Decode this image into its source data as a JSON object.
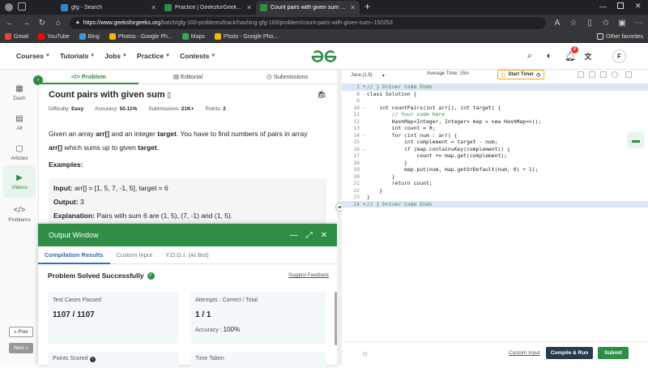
{
  "browser": {
    "tabs": [
      {
        "title": "gfg - Search",
        "color": "#2b87d1"
      },
      {
        "title": "Practice | GeeksforGeeks | A com",
        "color": "#2f8d46"
      },
      {
        "title": "Count pairs with given sum | Prac",
        "color": "#2f8d46"
      }
    ],
    "url_host": "https://www.geeksforgeeks.org",
    "url_path": "/batch/gfg-160-problems/track/hashing-gfg-160/problem/count-pairs-with-given-sum--150253",
    "bookmarks": [
      {
        "label": "Gmail",
        "color": "#ea4335"
      },
      {
        "label": "YouTube",
        "color": "#ff0000"
      },
      {
        "label": "Bing",
        "color": "#4c8fd6"
      },
      {
        "label": "Photos - Google Ph...",
        "color": "#f4b400"
      },
      {
        "label": "Maps",
        "color": "#34a853"
      },
      {
        "label": "Photo - Google Pho...",
        "color": "#f4b400"
      }
    ],
    "other_favorites": "Other favorites"
  },
  "site": {
    "nav": [
      "Courses",
      "Tutorials",
      "Jobs",
      "Practice",
      "Contests"
    ],
    "notification_count": "8",
    "avatar_letter": "F",
    "brand_color": "#2f8d46"
  },
  "rail": {
    "items": [
      {
        "label": "Dash",
        "icon": "dashboard-icon"
      },
      {
        "label": "All",
        "icon": "grid-icon"
      },
      {
        "label": "Articles",
        "icon": "article-icon"
      },
      {
        "label": "Videos",
        "icon": "video-icon"
      },
      {
        "label": "Problems",
        "icon": "code-icon"
      }
    ],
    "prev": "« Prev",
    "next": "Next »"
  },
  "problem": {
    "tabs": [
      "</> Problem",
      "Editorial",
      "Submissions"
    ],
    "title": "Count pairs with given sum",
    "difficulty_label": "Difficulty:",
    "difficulty": "Easy",
    "accuracy_label": "Accuracy:",
    "accuracy": "50.11%",
    "submissions_label": "Submissions:",
    "submissions": "21K+",
    "points_label": "Points:",
    "points": "2",
    "desc_1": "Given an array ",
    "desc_arr": "arr[]",
    "desc_2": " and an integer ",
    "desc_target": "target",
    "desc_3": ". You have to find numbers of pairs in array ",
    "desc_arr2": "arr[]",
    "desc_4": " which sums up to given ",
    "desc_target2": "target",
    "desc_5": ".",
    "examples": "Examples:",
    "ex_input_label": "Input:",
    "ex_input": " arr[] = [1, 5, 7, -1, 5], target = 6",
    "ex_output_label": "Output:",
    "ex_output": " 3",
    "ex_expl_label": "Explanation:",
    "ex_expl": " Pairs with sum 6 are (1, 5), (7, -1) and (1, 5)."
  },
  "output": {
    "title": "Output Window",
    "tabs": [
      "Compilation Results",
      "Custom Input",
      "Y.O.G.I. (AI Bot)"
    ],
    "status": "Problem Solved Successfully",
    "feedback": "Suggest Feedback",
    "tests_label": "Test Cases Passed",
    "tests_value": "1107 / 1107",
    "attempts_label": "Attempts : Correct / Total",
    "attempts_value": "1 / 1",
    "accuracy_label": "Accuracy :",
    "accuracy_value": "100%",
    "points_label": "Points Scored",
    "time_label": "Time Taken"
  },
  "editor": {
    "language": "Java (1.8)",
    "avg_time": "Average Time: 15m",
    "timer": "Start Timer",
    "custom_input": "Custom Input",
    "compile": "Compile & Run",
    "submit": "Submit",
    "lines": [
      {
        "n": "1",
        "fold": "+",
        "text": "// } Driver Code Ends",
        "hl": true,
        "cls": "cm"
      },
      {
        "n": "8",
        "fold": "-",
        "text": "class Solution {",
        "hl": false,
        "cls": ""
      },
      {
        "n": "9",
        "fold": "",
        "text": "",
        "hl": false,
        "cls": ""
      },
      {
        "n": "10",
        "fold": "-",
        "text": "    int countPairs(int arr[], int target) {",
        "hl": false,
        "cls": ""
      },
      {
        "n": "11",
        "fold": "",
        "text": "        // Your code here",
        "hl": false,
        "cls": "cm"
      },
      {
        "n": "12",
        "fold": "",
        "text": "        HashMap<Integer, Integer> map = new HashMap<>();",
        "hl": false,
        "cls": ""
      },
      {
        "n": "13",
        "fold": "",
        "text": "        int count = 0;",
        "hl": false,
        "cls": ""
      },
      {
        "n": "14",
        "fold": "-",
        "text": "        for (int num : arr) {",
        "hl": false,
        "cls": ""
      },
      {
        "n": "15",
        "fold": "",
        "text": "            int complement = target - num;",
        "hl": false,
        "cls": ""
      },
      {
        "n": "16",
        "fold": "-",
        "text": "            if (map.containsKey(complement)) {",
        "hl": false,
        "cls": ""
      },
      {
        "n": "17",
        "fold": "",
        "text": "                count += map.get(complement);",
        "hl": false,
        "cls": ""
      },
      {
        "n": "18",
        "fold": "",
        "text": "            }",
        "hl": false,
        "cls": ""
      },
      {
        "n": "19",
        "fold": "",
        "text": "            map.put(num, map.getOrDefault(num, 0) + 1);",
        "hl": false,
        "cls": ""
      },
      {
        "n": "20",
        "fold": "",
        "text": "        }",
        "hl": false,
        "cls": ""
      },
      {
        "n": "21",
        "fold": "",
        "text": "        return count;",
        "hl": false,
        "cls": ""
      },
      {
        "n": "22",
        "fold": "",
        "text": "    }",
        "hl": false,
        "cls": ""
      },
      {
        "n": "23",
        "fold": "",
        "text": "}",
        "hl": false,
        "cls": ""
      },
      {
        "n": "24",
        "fold": "+",
        "text": "// } Driver Code Ends",
        "hl": true,
        "cls": "cm"
      }
    ]
  }
}
